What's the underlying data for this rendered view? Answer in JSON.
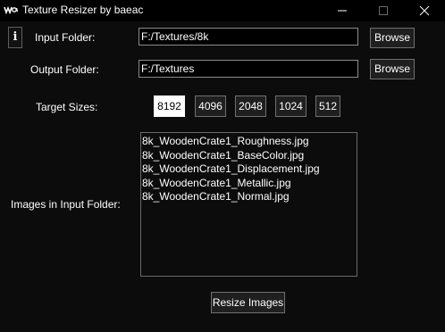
{
  "window": {
    "title": "Texture Resizer by baeac",
    "icon": "waveform-logo-icon",
    "controls": [
      "minimize-icon",
      "maximize-icon",
      "close-icon"
    ]
  },
  "info_button": {
    "label": "i"
  },
  "input_folder": {
    "label": "Input Folder:",
    "value": "F:/Textures/8k",
    "browse_label": "Browse"
  },
  "output_folder": {
    "label": "Output Folder:",
    "value": "F:/Textures",
    "browse_label": "Browse"
  },
  "target_sizes": {
    "label": "Target Sizes:",
    "options": [
      "8192",
      "4096",
      "2048",
      "1024",
      "512"
    ],
    "selected": "8192"
  },
  "images": {
    "label": "Images in Input Folder:",
    "files": [
      "8k_WoodenCrate1_Roughness.jpg",
      "8k_WoodenCrate1_BaseColor.jpg",
      "8k_WoodenCrate1_Displacement.jpg",
      "8k_WoodenCrate1_Metallic.jpg",
      "8k_WoodenCrate1_Normal.jpg"
    ]
  },
  "resize_button": {
    "label": "Resize Images"
  },
  "colors": {
    "background": "#0c0c0c",
    "titlebar": "#000000",
    "selected_size": "#ffffff",
    "border": "#707070"
  }
}
